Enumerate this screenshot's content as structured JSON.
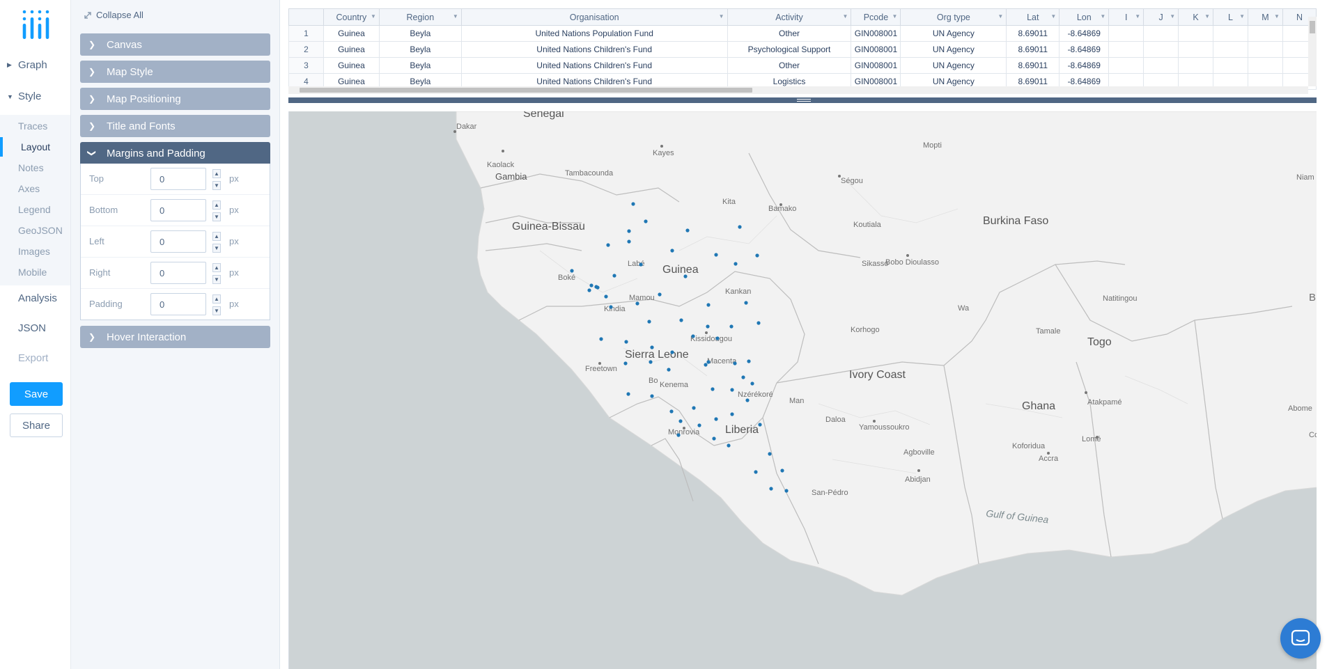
{
  "nav": {
    "graph_label": "Graph",
    "style_label": "Style",
    "style_items": [
      "Traces",
      "Layout",
      "Notes",
      "Axes",
      "Legend",
      "GeoJSON",
      "Images",
      "Mobile"
    ],
    "active_style_item": "Layout",
    "analysis_label": "Analysis",
    "json_label": "JSON",
    "export_label": "Export",
    "save_label": "Save",
    "share_label": "Share",
    "accent_color": "#119dff"
  },
  "panel": {
    "collapse_all_label": "Collapse All",
    "sections": [
      "Canvas",
      "Map Style",
      "Map Positioning",
      "Title and Fonts",
      "Margins and Padding",
      "Hover Interaction"
    ],
    "open_section": "Margins and Padding",
    "margins": {
      "rows": [
        {
          "label": "Top",
          "value": "0",
          "unit": "px"
        },
        {
          "label": "Bottom",
          "value": "0",
          "unit": "px"
        },
        {
          "label": "Left",
          "value": "0",
          "unit": "px"
        },
        {
          "label": "Right",
          "value": "0",
          "unit": "px"
        },
        {
          "label": "Padding",
          "value": "0",
          "unit": "px"
        }
      ]
    }
  },
  "grid": {
    "columns": [
      "Country",
      "Region",
      "Organisation",
      "Activity",
      "Pcode",
      "Org type",
      "Lat",
      "Lon",
      "I",
      "J",
      "K",
      "L",
      "M",
      "N"
    ],
    "rows": [
      {
        "n": "1",
        "cells": [
          "Guinea",
          "Beyla",
          "United Nations Population Fund",
          "Other",
          "GIN008001",
          "UN Agency",
          "8.69011",
          "-8.64869"
        ]
      },
      {
        "n": "2",
        "cells": [
          "Guinea",
          "Beyla",
          "United Nations Children's Fund",
          "Psychological Support",
          "GIN008001",
          "UN Agency",
          "8.69011",
          "-8.64869"
        ]
      },
      {
        "n": "3",
        "cells": [
          "Guinea",
          "Beyla",
          "United Nations Children's Fund",
          "Other",
          "GIN008001",
          "UN Agency",
          "8.69011",
          "-8.64869"
        ]
      },
      {
        "n": "4",
        "cells": [
          "Guinea",
          "Beyla",
          "United Nations Children's Fund",
          "Logistics",
          "GIN008001",
          "UN Agency",
          "8.69011",
          "-8.64869"
        ]
      }
    ]
  },
  "map": {
    "style": "light",
    "ocean_color": "#cdd3d5",
    "land_color": "#f2f2f2",
    "marker_color": "#1f77b4",
    "country_labels": [
      "Senegal",
      "Gambia",
      "Guinea-Bissau",
      "Guinea",
      "Sierra Leone",
      "Liberia",
      "Ivory Coast",
      "Burkina Faso",
      "Ghana",
      "Togo"
    ],
    "city_labels": [
      "Dakar",
      "Kaolack",
      "Tambacounda",
      "Kayes",
      "Ségou",
      "Mopti",
      "Niam",
      "Kita",
      "Bamako",
      "Koutiala",
      "Sikasso",
      "Bobo Dioulasso",
      "Natitingou",
      "B",
      "Boké",
      "Labé",
      "Mamou",
      "Kindia",
      "Kankan",
      "Kissidougou",
      "Freetown",
      "Bo",
      "Kenema",
      "Macenta",
      "Nzérékoré",
      "Man",
      "Korhogo",
      "Wa",
      "Tamale",
      "Daloa",
      "Yamoussoukro",
      "Monrovia",
      "Agboville",
      "Abidjan",
      "San-Pédro",
      "Koforidua",
      "Accra",
      "Lomé",
      "Atakpamé",
      "Abome",
      "Co"
    ],
    "sea_label": "Gulf of Guinea"
  }
}
